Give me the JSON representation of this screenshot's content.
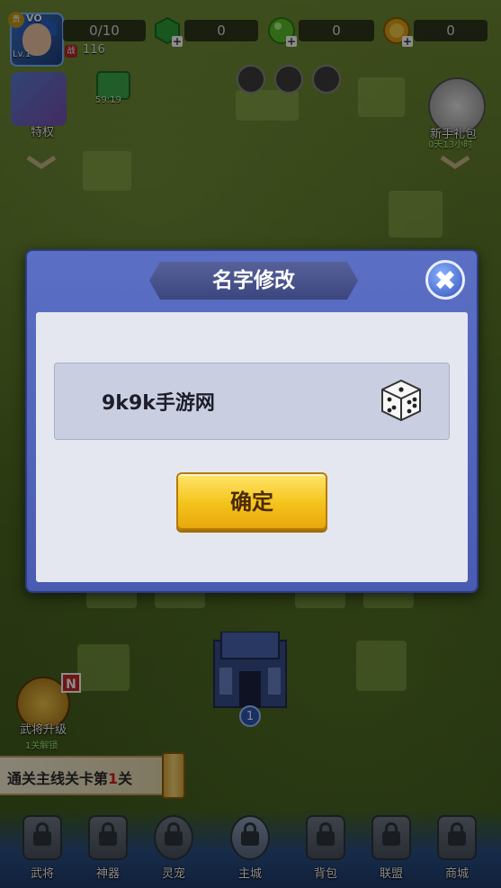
{
  "player": {
    "vip_label": "VO",
    "vip_badge": "贵",
    "level": "Lv.1",
    "stamina": "0/10",
    "power_icon": "战",
    "power": "116"
  },
  "resources": [
    {
      "name": "green-gem",
      "value": "0",
      "color": "#2f9e3a"
    },
    {
      "name": "green-orb",
      "value": "0",
      "color": "#5bbf2a"
    },
    {
      "name": "gold-coin",
      "value": "0",
      "color": "#e0a11a"
    }
  ],
  "left_menu": {
    "privilege_label": "特权",
    "timer": "59:19"
  },
  "right_menu": {
    "gift_label": "新手礼包",
    "gift_time": "0天13小时"
  },
  "modal": {
    "title": "名字修改",
    "name_value": "9k9k手游网",
    "confirm_label": "确定",
    "close_glyph": "✖"
  },
  "castle": {
    "level": "1"
  },
  "upgrade": {
    "label": "武将升级",
    "badge": "N",
    "sub": "1关解锁"
  },
  "quest": {
    "prefix": "通关主线关卡第",
    "number": "1",
    "suffix": "关"
  },
  "nav": [
    {
      "label": "武将"
    },
    {
      "label": "神器"
    },
    {
      "label": "灵宠"
    },
    {
      "label": "主城"
    },
    {
      "label": "背包"
    },
    {
      "label": "联盟"
    },
    {
      "label": "商城"
    }
  ]
}
